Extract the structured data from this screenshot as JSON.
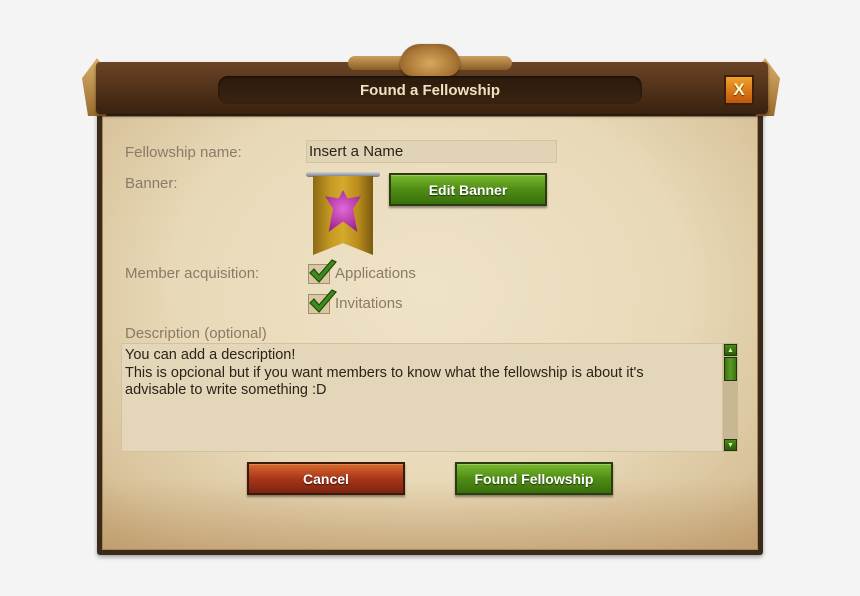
{
  "dialog": {
    "title": "Found a Fellowship",
    "close_label": "X"
  },
  "form": {
    "name_label": "Fellowship name:",
    "name_value": "Insert a Name",
    "banner_label": "Banner:",
    "edit_banner_label": "Edit Banner",
    "acquisition_label": "Member acquisition:",
    "applications_label": "Applications",
    "applications_checked": true,
    "invitations_label": "Invitations",
    "invitations_checked": true,
    "description_label": "Description (optional)",
    "description_lines": [
      "You can add a description!",
      "This is opcional but if you want members to know what the fellowship is about it's",
      "advisable to write something :D"
    ]
  },
  "actions": {
    "cancel_label": "Cancel",
    "found_label": "Found Fellowship"
  },
  "icons": {
    "close": "close-icon",
    "check": "checkmark-icon",
    "banner_emblem": "phoenix-emblem-icon",
    "scroll_up": "arrow-up-icon",
    "scroll_down": "arrow-down-icon"
  },
  "colors": {
    "accent_green": "#4f8c15",
    "cancel_red": "#a8361a",
    "close_orange": "#e07a1a",
    "banner_gold": "#c79a22",
    "emblem_magenta": "#b0359f"
  }
}
